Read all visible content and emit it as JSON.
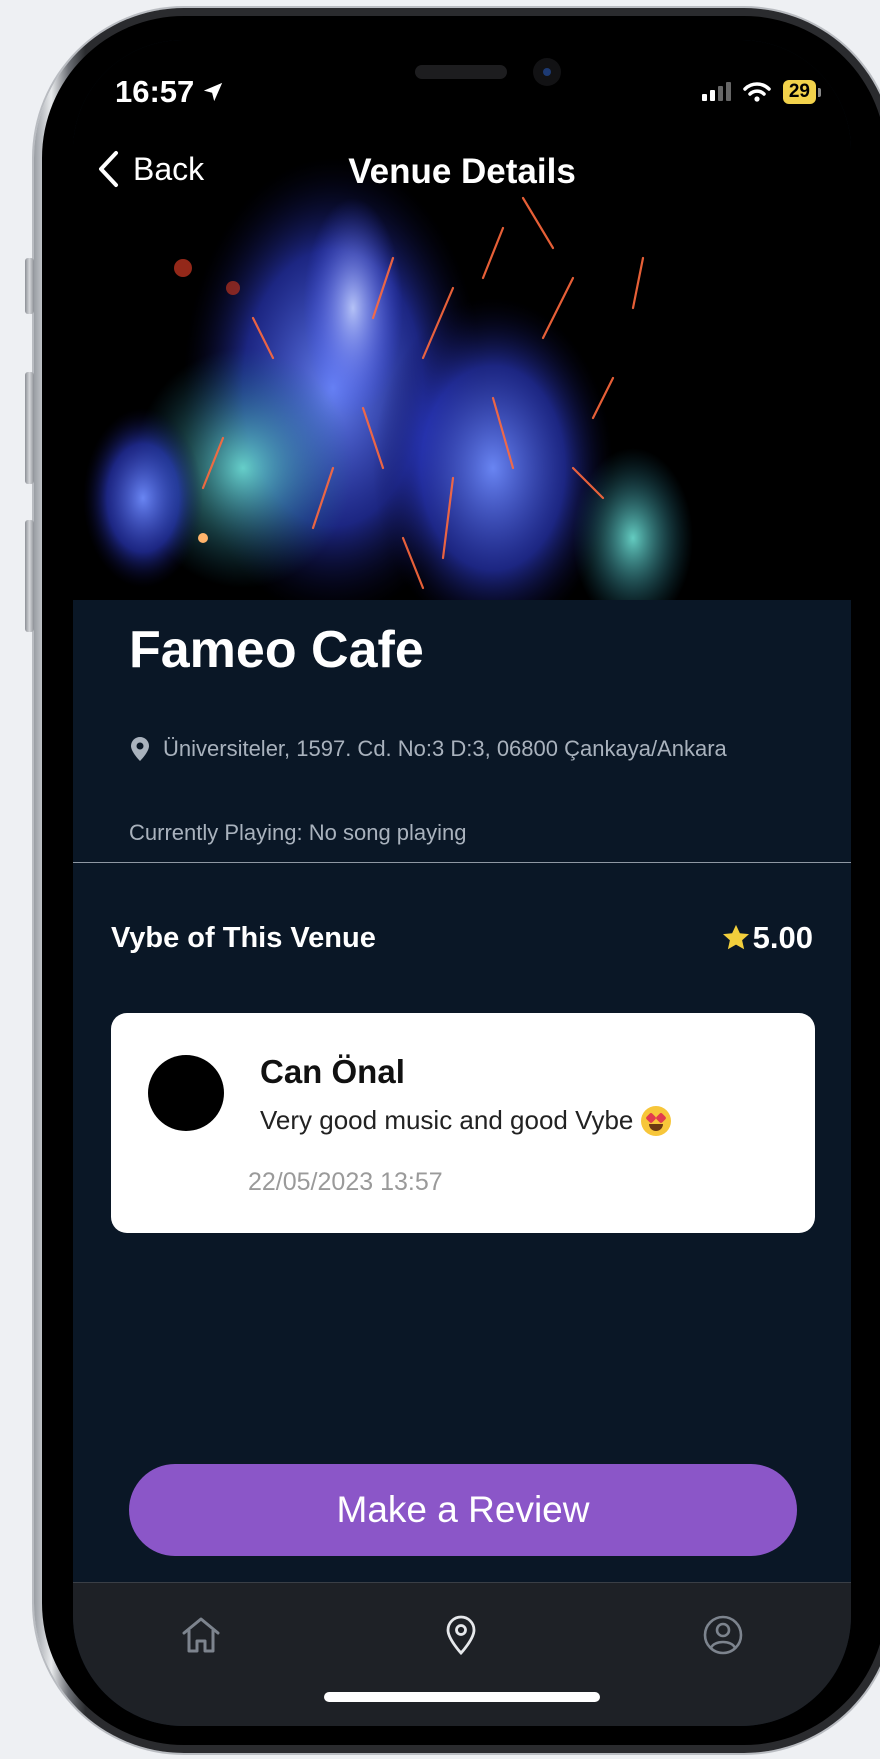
{
  "status_bar": {
    "time": "16:57",
    "battery": "29"
  },
  "nav": {
    "back_label": "Back",
    "title": "Venue Details"
  },
  "venue": {
    "name": "Fameo Cafe",
    "address": "Üniversiteler, 1597. Cd. No:3 D:3, 06800 Çankaya/Ankara",
    "currently_playing": "Currently Playing: No song playing"
  },
  "vybe": {
    "title": "Vybe of This Venue",
    "rating": "5.00"
  },
  "reviews": [
    {
      "name": "Can Önal",
      "text": "Very good music and good Vybe",
      "date": "22/05/2023 13:57"
    }
  ],
  "cta": {
    "label": "Make a Review"
  },
  "tab_bar": {
    "items": [
      "home-icon",
      "map-pin-icon",
      "profile-icon"
    ],
    "active": "map-pin-icon"
  },
  "colors": {
    "background": "#0a1726",
    "accent": "#8b56c8",
    "star": "#f2cf3c"
  }
}
